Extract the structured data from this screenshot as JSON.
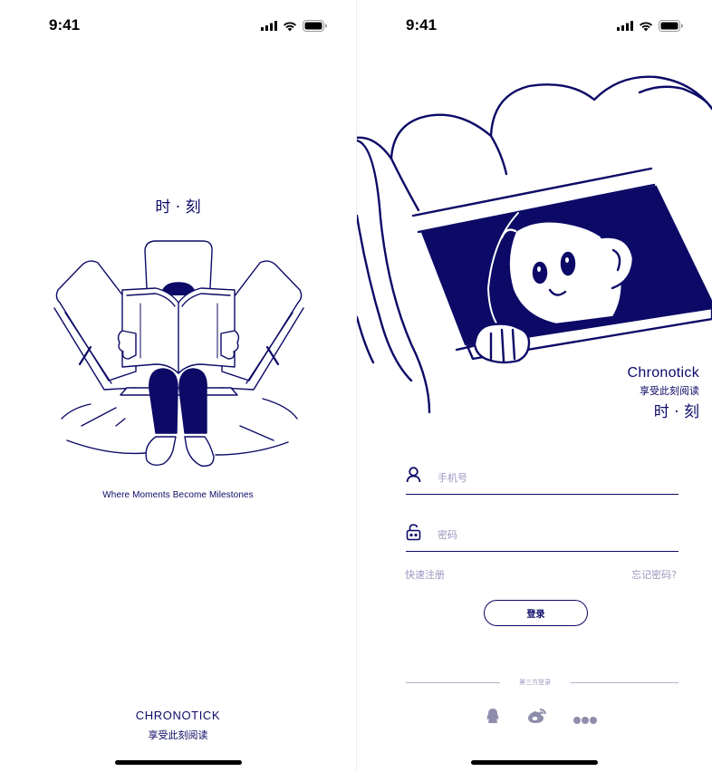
{
  "status_bar": {
    "time": "9:41"
  },
  "splash": {
    "title": "时 · 刻",
    "tagline": "Where Moments Become Milestones",
    "brand": "CHRONOTICK",
    "slogan": "享受此刻阅读"
  },
  "login": {
    "brand_en": "Chronotick",
    "brand_slogan": "享受此刻阅读",
    "brand_cn": "时 · 刻",
    "phone_placeholder": "手机号",
    "password_placeholder": "密码",
    "register_link": "快速注册",
    "forgot_link": "忘记密码?",
    "login_button": "登录",
    "third_party_label": "第三方登录",
    "social_icons": [
      "qq-icon",
      "weibo-icon",
      "more-icon"
    ]
  },
  "colors": {
    "primary": "#0c0a66",
    "muted": "#9a98c0",
    "background": "#ffffff"
  }
}
